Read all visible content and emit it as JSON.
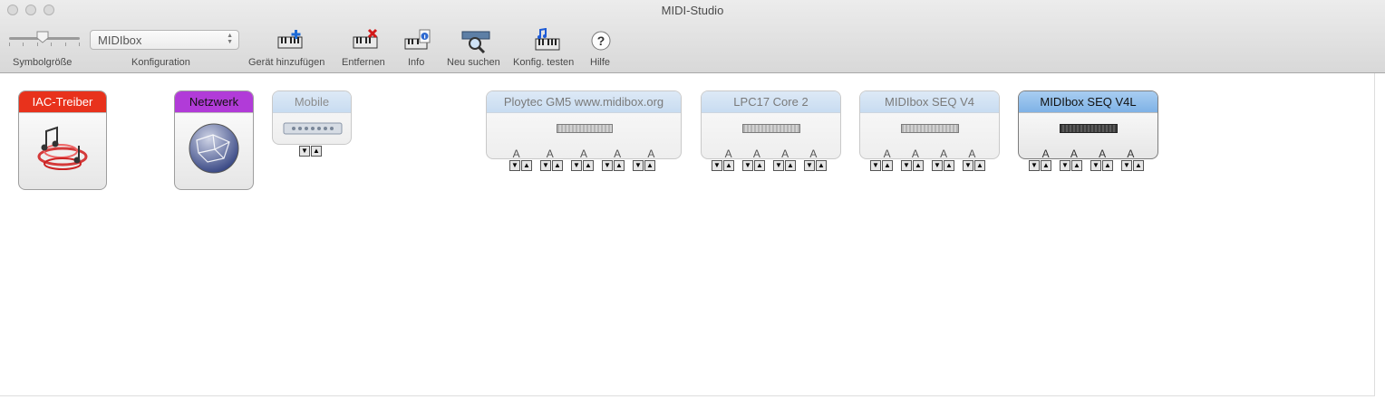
{
  "window": {
    "title": "MIDI-Studio"
  },
  "toolbar": {
    "icon_size_label": "Symbolgröße",
    "config_label": "Konfiguration",
    "config_value": "MIDIbox",
    "buttons": [
      {
        "label": "Gerät hinzufügen",
        "icon": "add-device-icon"
      },
      {
        "label": "Entfernen",
        "icon": "remove-icon"
      },
      {
        "label": "Info",
        "icon": "info-icon"
      },
      {
        "label": "Neu suchen",
        "icon": "rescan-icon"
      },
      {
        "label": "Konfig. testen",
        "icon": "test-config-icon"
      },
      {
        "label": "Hilfe",
        "icon": "help-icon"
      }
    ]
  },
  "devices": [
    {
      "name": "IAC-Treiber",
      "icon": "iac-driver-icon",
      "header_color": "#e8321c"
    },
    {
      "name": "Netzwerk",
      "icon": "network-globe-icon",
      "header_color": "#b13bd8"
    },
    {
      "name": "Mobile",
      "icon": "interface-panel-icon"
    },
    {
      "name": "Ploytec GM5 www.midibox.org",
      "ports": [
        "A",
        "A",
        "A",
        "A",
        "A"
      ]
    },
    {
      "name": "LPC17 Core 2",
      "ports": [
        "A",
        "A",
        "A",
        "A"
      ]
    },
    {
      "name": "MIDIbox SEQ V4",
      "ports": [
        "A",
        "A",
        "A",
        "A"
      ]
    },
    {
      "name": "MIDIbox SEQ V4L",
      "ports": [
        "A",
        "A",
        "A",
        "A"
      ],
      "selected": true
    }
  ],
  "port_arrows": {
    "in": "▼",
    "out": "▲"
  },
  "colors": {
    "selection": "#7fb2e6",
    "toolbar_bg": "#dcdcdc"
  }
}
